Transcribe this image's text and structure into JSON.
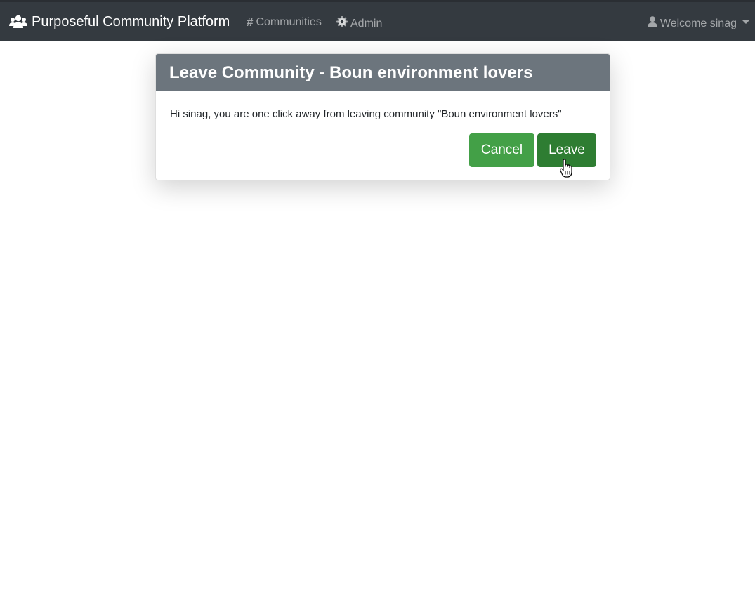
{
  "navbar": {
    "brand": "Purposeful Community Platform",
    "brand_icon": "users-icon",
    "links": [
      {
        "label": "Communities",
        "icon": "hashtag-icon"
      },
      {
        "label": "Admin",
        "icon": "gear-icon"
      }
    ],
    "user_menu": {
      "label": "Welcome sinag",
      "icon": "user-icon"
    }
  },
  "dialog": {
    "title": "Leave Community - Boun environment lovers",
    "message": "Hi sinag, you are one click away from leaving community \"Boun environment lovers\"",
    "cancel_label": "Cancel",
    "leave_label": "Leave"
  },
  "colors": {
    "navbar_bg": "#343a40",
    "header_bg": "#6c757d",
    "cancel_bg": "#43a047",
    "leave_bg": "#2e7d32"
  }
}
